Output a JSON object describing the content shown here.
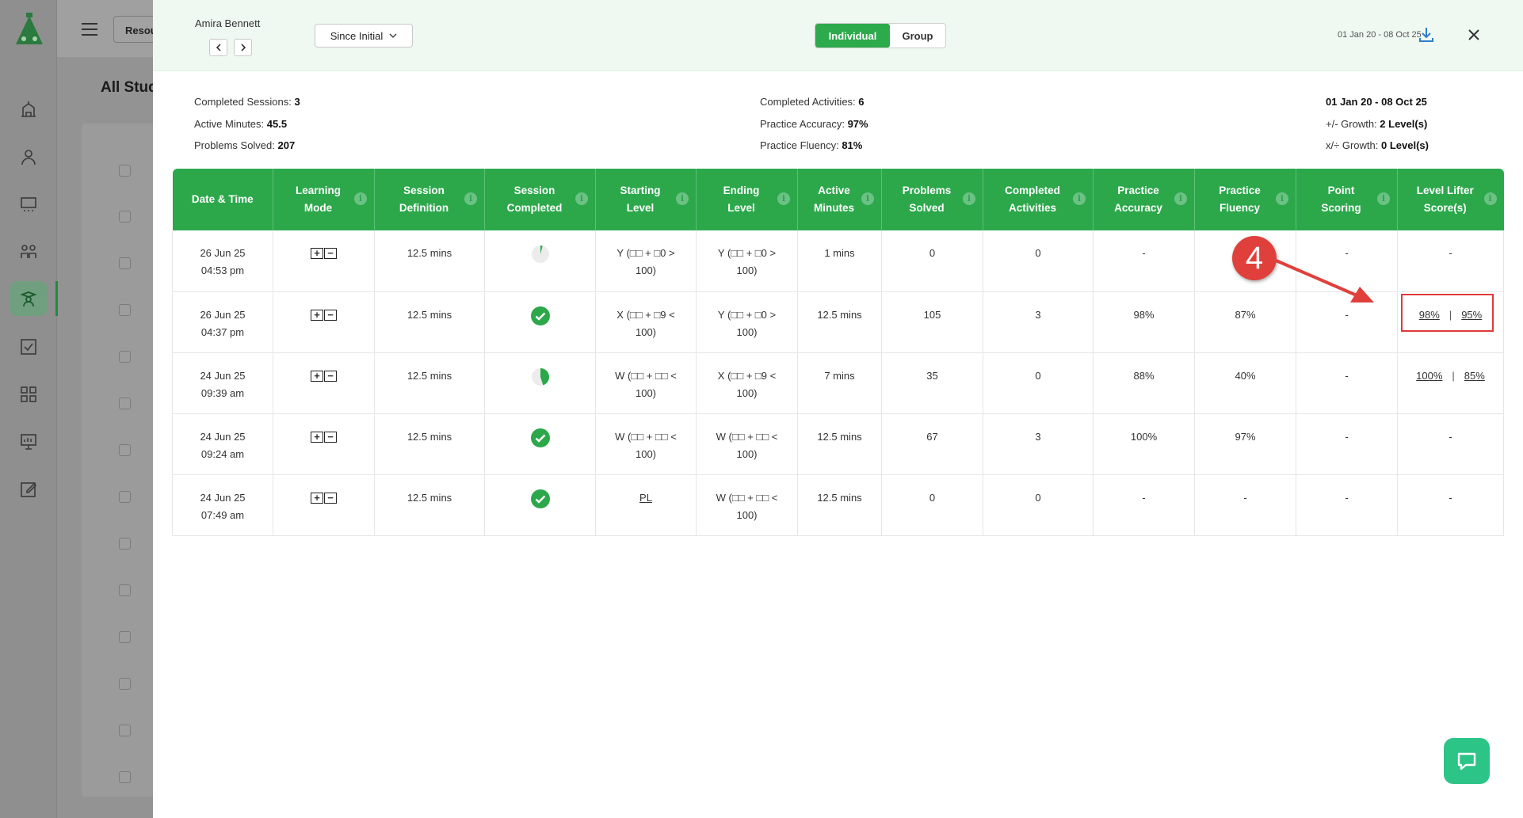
{
  "background": {
    "resource_button": "Resou",
    "page_title": "All Stude"
  },
  "modal": {
    "student_name": "Amira Bennett",
    "range_select": "Since Initial",
    "toggle": {
      "individual": "Individual",
      "group": "Group"
    },
    "header_date": "01 Jan 20 - 08 Oct 25",
    "summary_left": [
      {
        "label": "Completed Sessions:",
        "value": "3"
      },
      {
        "label": "Active Minutes:",
        "value": "45.5"
      },
      {
        "label": "Problems Solved:",
        "value": "207"
      }
    ],
    "summary_mid": [
      {
        "label": "Completed Activities:",
        "value": "6"
      },
      {
        "label": "Practice Accuracy:",
        "value": "97%"
      },
      {
        "label": "Practice Fluency:",
        "value": "81%"
      }
    ],
    "summary_right": {
      "date_range": "01 Jan 20 - 08 Oct 25",
      "add_sub_growth_label": "+/- Growth:",
      "add_sub_growth_value": "2 Level(s)",
      "mul_div_growth_label": "x/÷ Growth:",
      "mul_div_growth_value": "0 Level(s)"
    },
    "table": {
      "headers": [
        [
          "Date & Time",
          ""
        ],
        [
          "Learning",
          "Mode"
        ],
        [
          "Session",
          "Definition"
        ],
        [
          "Session",
          "Completed"
        ],
        [
          "Starting",
          "Level"
        ],
        [
          "Ending",
          "Level"
        ],
        [
          "Active",
          "Minutes"
        ],
        [
          "Problems",
          "Solved"
        ],
        [
          "Completed",
          "Activities"
        ],
        [
          "Practice",
          "Accuracy"
        ],
        [
          "Practice",
          "Fluency"
        ],
        [
          "Point",
          "Scoring"
        ],
        [
          "Level Lifter",
          "Score(s)"
        ]
      ],
      "rows": [
        {
          "date": "26 Jun 25",
          "time": "04:53 pm",
          "definition": "12.5 mins",
          "completed_fraction": 0.04,
          "start": [
            "Y (□□ + □0 >",
            "100)"
          ],
          "end": [
            "Y (□□ + □0 >",
            "100)"
          ],
          "minutes": "1 mins",
          "problems": "0",
          "activities": "0",
          "accuracy": "-",
          "fluency": "",
          "points": "-",
          "lls": [
            "-"
          ]
        },
        {
          "date": "26 Jun 25",
          "time": "04:37 pm",
          "definition": "12.5 mins",
          "completed_fraction": 1,
          "start": [
            "X (□□ + □9 <",
            "100)"
          ],
          "end": [
            "Y (□□ + □0 >",
            "100)"
          ],
          "minutes": "12.5 mins",
          "problems": "105",
          "activities": "3",
          "accuracy": "98%",
          "fluency": "87%",
          "points": "-",
          "lls": [
            "98%",
            "95%"
          ]
        },
        {
          "date": "24 Jun 25",
          "time": "09:39 am",
          "definition": "12.5 mins",
          "completed_fraction": 0.45,
          "start": [
            "W (□□ + □□ <",
            "100)"
          ],
          "end": [
            "X (□□ + □9 <",
            "100)"
          ],
          "minutes": "7 mins",
          "problems": "35",
          "activities": "0",
          "accuracy": "88%",
          "fluency": "40%",
          "points": "-",
          "lls": [
            "100%",
            "85%"
          ]
        },
        {
          "date": "24 Jun 25",
          "time": "09:24 am",
          "definition": "12.5 mins",
          "completed_fraction": 1,
          "start": [
            "W (□□ + □□ <",
            "100)"
          ],
          "end": [
            "W (□□ + □□ <",
            "100)"
          ],
          "minutes": "12.5 mins",
          "problems": "67",
          "activities": "3",
          "accuracy": "100%",
          "fluency": "97%",
          "points": "-",
          "lls": [
            "-"
          ]
        },
        {
          "date": "24 Jun 25",
          "time": "07:49 am",
          "definition": "12.5 mins",
          "completed_fraction": 1,
          "start": [
            "PL"
          ],
          "end": [
            "W (□□ + □□ <",
            "100)"
          ],
          "minutes": "12.5 mins",
          "problems": "0",
          "activities": "0",
          "accuracy": "-",
          "fluency": "-",
          "points": "-",
          "lls": [
            "-"
          ]
        }
      ]
    }
  },
  "annotation": {
    "callout_number": "4",
    "color": "#e0403b"
  },
  "colors": {
    "primary_green": "#2ca84b",
    "header_bg": "#eff8f1",
    "chat_green": "#2dc487"
  }
}
